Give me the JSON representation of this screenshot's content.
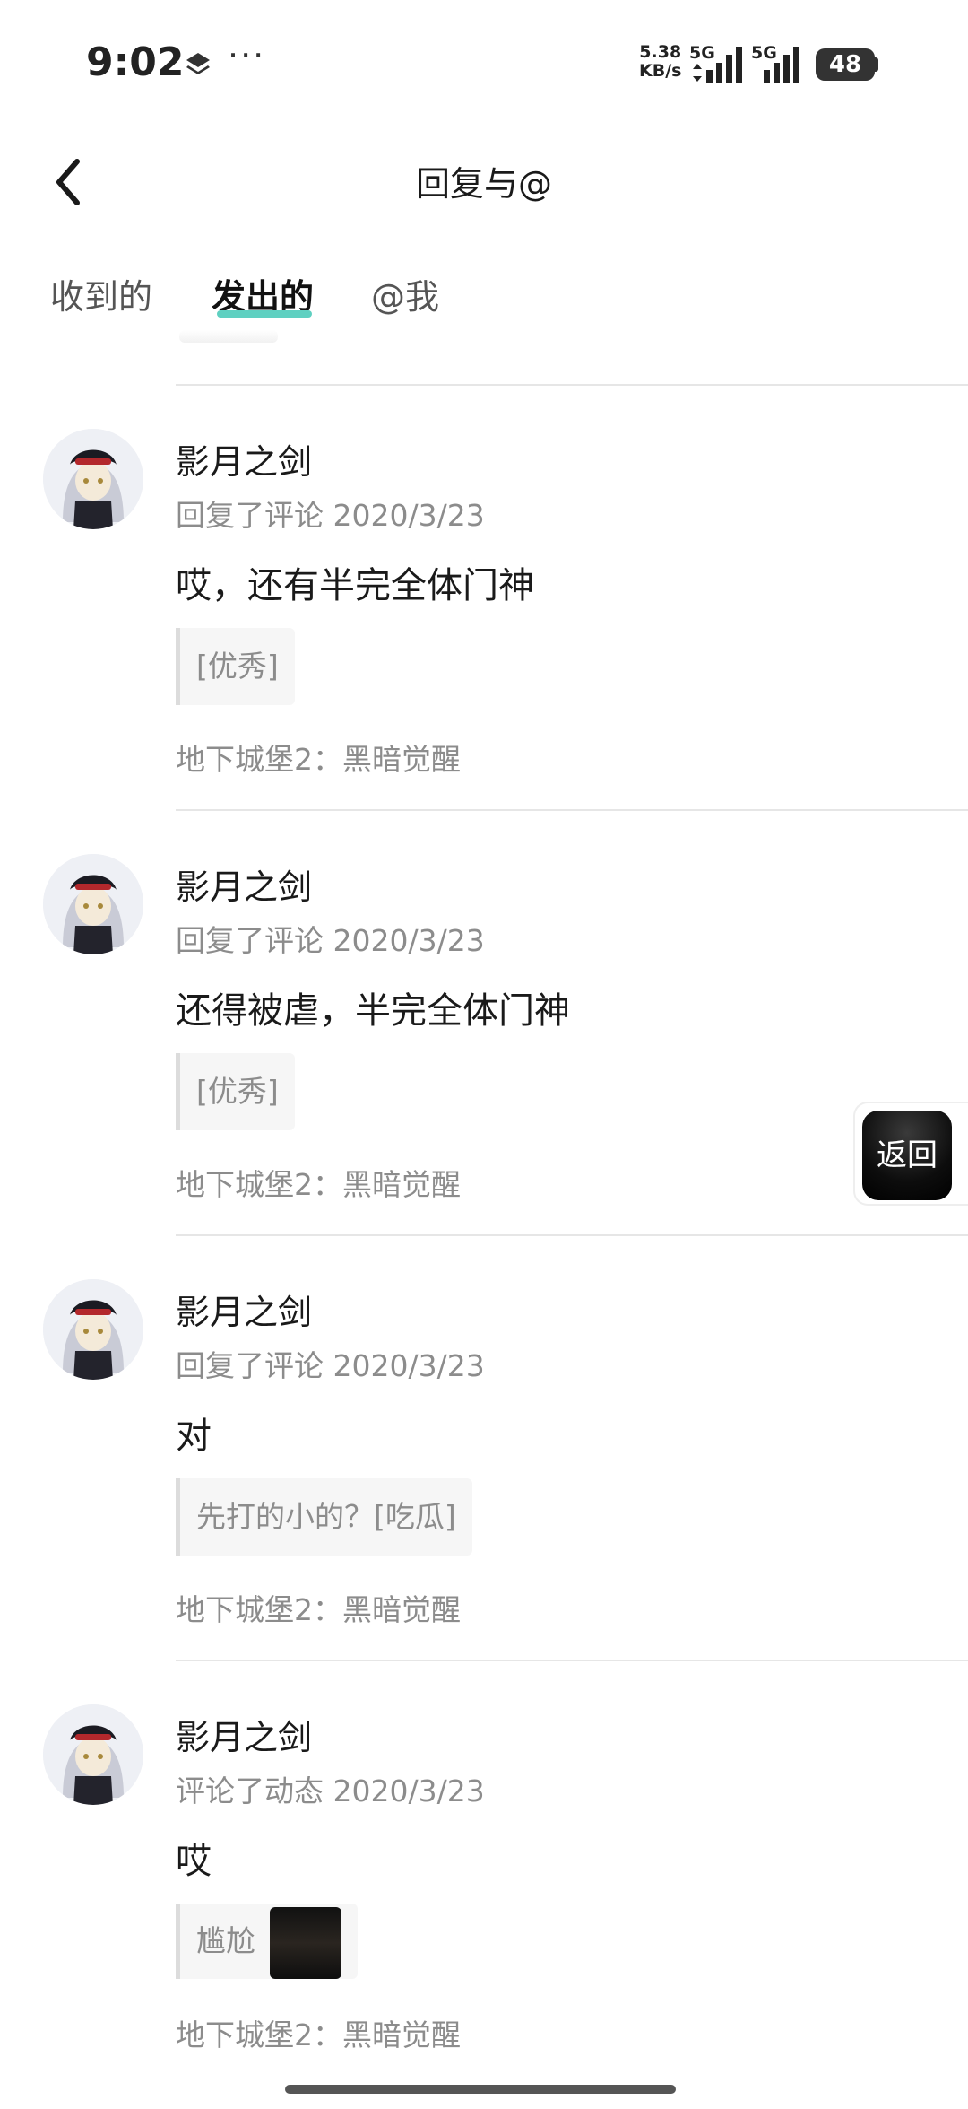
{
  "status_bar": {
    "time": "9:02",
    "net_speed_value": "5.38",
    "net_speed_unit": "KB/s",
    "sim1_label": "5G",
    "sim2_label": "5G",
    "battery": "48",
    "icons": [
      "layers-icon",
      "more-dots-icon",
      "signal-icon",
      "battery-icon"
    ]
  },
  "nav": {
    "title": "回复与@",
    "back_icon": "chevron-left-icon"
  },
  "tabs": [
    {
      "label": "收到的",
      "active": false
    },
    {
      "label": "发出的",
      "active": true
    },
    {
      "label": "@我",
      "active": false
    }
  ],
  "accent_color": "#5fd0c1",
  "items": [
    {
      "name": "影月之剑",
      "meta": "回复了评论 2020/3/23",
      "content": "哎，还有半完全体门神",
      "quote": "[优秀]",
      "source": "地下城堡2：黑暗觉醒"
    },
    {
      "name": "影月之剑",
      "meta": "回复了评论 2020/3/23",
      "content": "还得被虐，半完全体门神",
      "quote": "[优秀]",
      "source": "地下城堡2：黑暗觉醒"
    },
    {
      "name": "影月之剑",
      "meta": "回复了评论 2020/3/23",
      "content": "对",
      "quote": "先打的小的？[吃瓜]",
      "source": "地下城堡2：黑暗觉醒"
    },
    {
      "name": "影月之剑",
      "meta": "评论了动态 2020/3/23",
      "content": "哎",
      "quote": "尴尬",
      "source": "地下城堡2：黑暗觉醒"
    }
  ],
  "float_back": {
    "label": "返回"
  }
}
